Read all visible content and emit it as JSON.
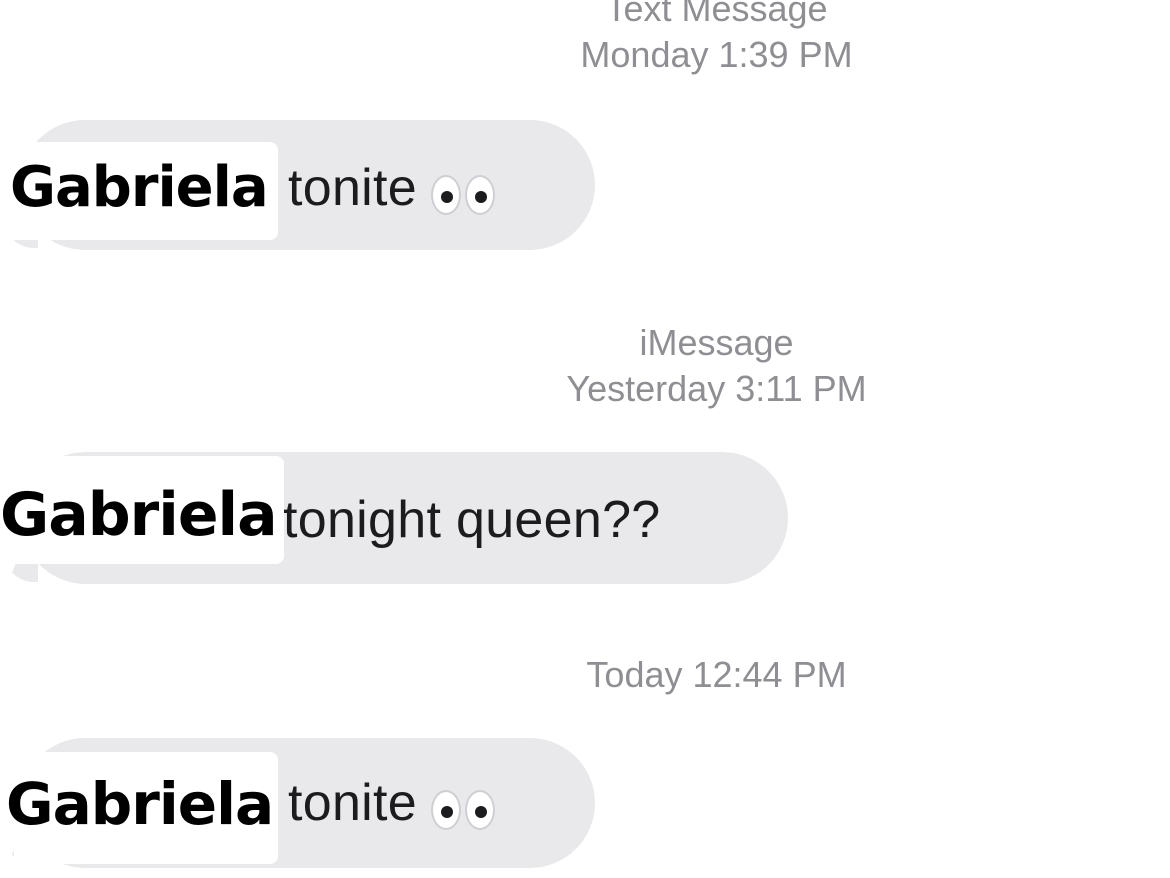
{
  "conversation": {
    "groups": [
      {
        "service": "Text Message",
        "timestamp": "Monday 1:39 PM",
        "name": "Gabriela",
        "message": "tonite",
        "emoji": "eyes-emoji"
      },
      {
        "service": "iMessage",
        "timestamp": "Yesterday 3:11 PM",
        "name": "Gabriela",
        "message": "tonight queen??",
        "emoji": ""
      },
      {
        "service": "",
        "timestamp": "Today 12:44 PM",
        "name": "Gabriela",
        "message": "tonite",
        "emoji": "eyes-emoji"
      }
    ]
  },
  "colors": {
    "received_bubble": "#e9e9eb",
    "timestamp_gray": "#8e8e93",
    "background": "#ffffff"
  }
}
